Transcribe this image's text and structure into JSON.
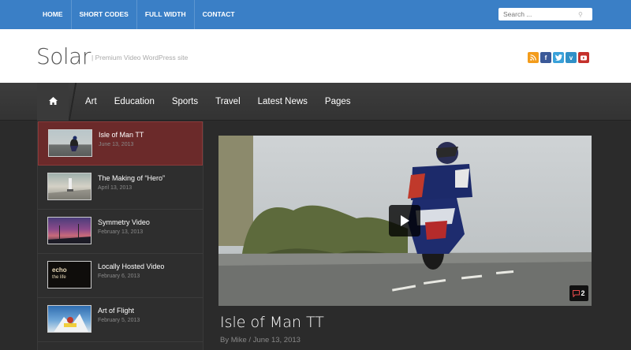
{
  "topnav": {
    "items": [
      "HOME",
      "SHORT CODES",
      "FULL WIDTH",
      "CONTACT"
    ]
  },
  "search": {
    "placeholder": "Search ..."
  },
  "header": {
    "logo": "Solar",
    "tagline": "| Premium Video WordPress site"
  },
  "social": [
    {
      "icon": "rss-icon",
      "color": "#f39c1b",
      "glyph": "◉"
    },
    {
      "icon": "facebook-icon",
      "color": "#3b5998",
      "glyph": "f"
    },
    {
      "icon": "twitter-icon",
      "color": "#3aa1d9",
      "glyph": "t"
    },
    {
      "icon": "vimeo-icon",
      "color": "#3090c7",
      "glyph": "v"
    },
    {
      "icon": "youtube-icon",
      "color": "#c4302b",
      "glyph": "▶"
    }
  ],
  "mainnav": {
    "home_icon": "home-icon",
    "links": [
      "Art",
      "Education",
      "Sports",
      "Travel",
      "Latest News",
      "Pages"
    ]
  },
  "sidebar": {
    "items": [
      {
        "title": "Isle of Man TT",
        "date": "June 13, 2013",
        "active": true
      },
      {
        "title": "The Making of “Hero”",
        "date": "April 13, 2013",
        "active": false
      },
      {
        "title": "Symmetry Video",
        "date": "February 13, 2013",
        "active": false
      },
      {
        "title": "Locally Hosted Video",
        "date": "February 6, 2013",
        "active": false,
        "thumb_text": "echo\nthe life"
      },
      {
        "title": "Art of Flight",
        "date": "February 5, 2013",
        "active": false
      }
    ]
  },
  "featured": {
    "title": "Isle of Man TT",
    "meta": "By Mike / June 13, 2013",
    "comments": "2"
  },
  "colors": {
    "topbar": "#3a7fc6",
    "active_item": "#6b2a2a",
    "background": "#2b2b2b"
  }
}
